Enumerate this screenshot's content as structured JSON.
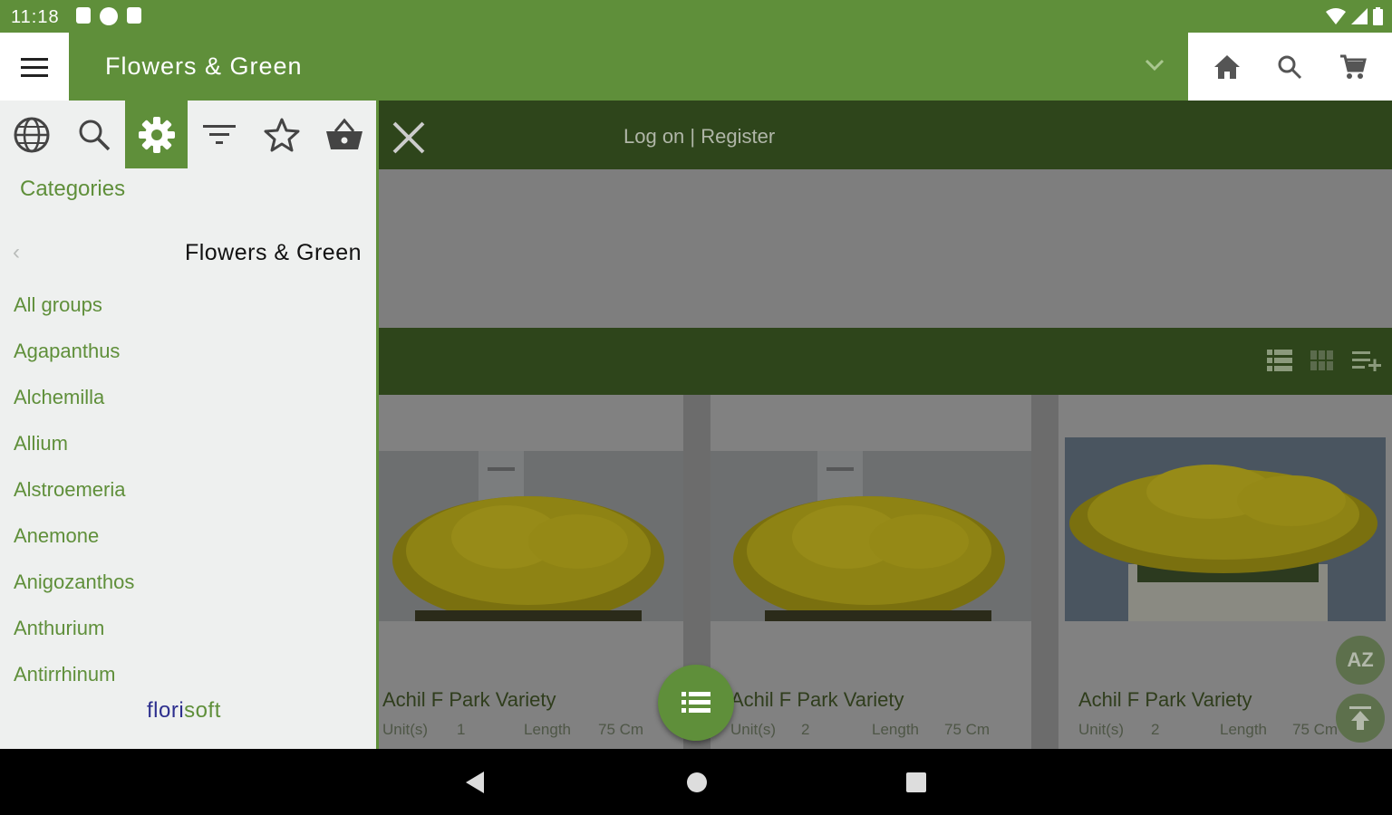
{
  "status_bar": {
    "time": "11:18"
  },
  "app_bar": {
    "title": "Flowers & Green"
  },
  "drawer": {
    "tabs": [
      "globe-icon",
      "search-icon",
      "settings-icon",
      "filter-icon",
      "star-icon",
      "basket-icon"
    ],
    "categories_label": "Categories",
    "current_group": "Flowers & Green",
    "items": [
      "All groups",
      "Agapanthus",
      "Alchemilla",
      "Allium",
      "Alstroemeria",
      "Anemone",
      "Anigozanthos",
      "Anthurium",
      "Antirrhinum"
    ],
    "logo_part1": "flori",
    "logo_part2": "soft"
  },
  "main": {
    "login_text": "Log on | Register",
    "products": [
      {
        "name": "Achil F Park Variety",
        "units_label": "Unit(s)",
        "units": "1",
        "length_label": "Length",
        "length": "75 Cm"
      },
      {
        "name": "Achil F Park Variety",
        "units_label": "Unit(s)",
        "units": "2",
        "length_label": "Length",
        "length": "75 Cm"
      },
      {
        "name": "Achil F Park Variety",
        "units_label": "Unit(s)",
        "units": "2",
        "length_label": "Length",
        "length": "75 Cm"
      }
    ],
    "sort_label": "AZ"
  },
  "colors": {
    "primary": "#5f8f3a",
    "dark_green": "#2e451b",
    "overlay_gray": "#818181"
  }
}
